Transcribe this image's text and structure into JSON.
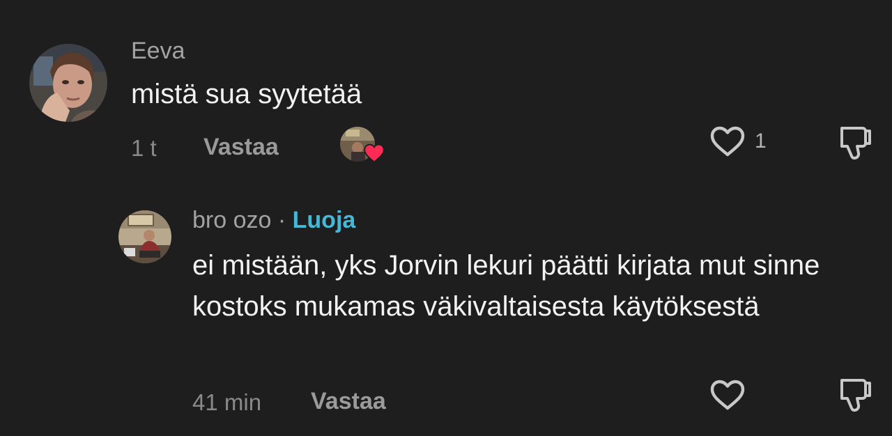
{
  "comments": [
    {
      "username": "Eeva",
      "text": "mistä sua syytetää",
      "time": "1 t",
      "reply_label": "Vastaa",
      "like_count": "1"
    },
    {
      "username": "bro ozo",
      "separator": "·",
      "badge": "Luoja",
      "text": "ei mistään, yks Jorvin lekuri päätti kirjata mut sinne kostoks mukamas väkivaltaisesta käytöksestä",
      "time": "41 min",
      "reply_label": "Vastaa"
    }
  ],
  "colors": {
    "background": "#1e1e1e",
    "badge": "#46b8d6",
    "creator_heart": "#fe2c55"
  },
  "icons": [
    "heart-icon",
    "dislike-icon",
    "creator-liked-heart-icon"
  ]
}
